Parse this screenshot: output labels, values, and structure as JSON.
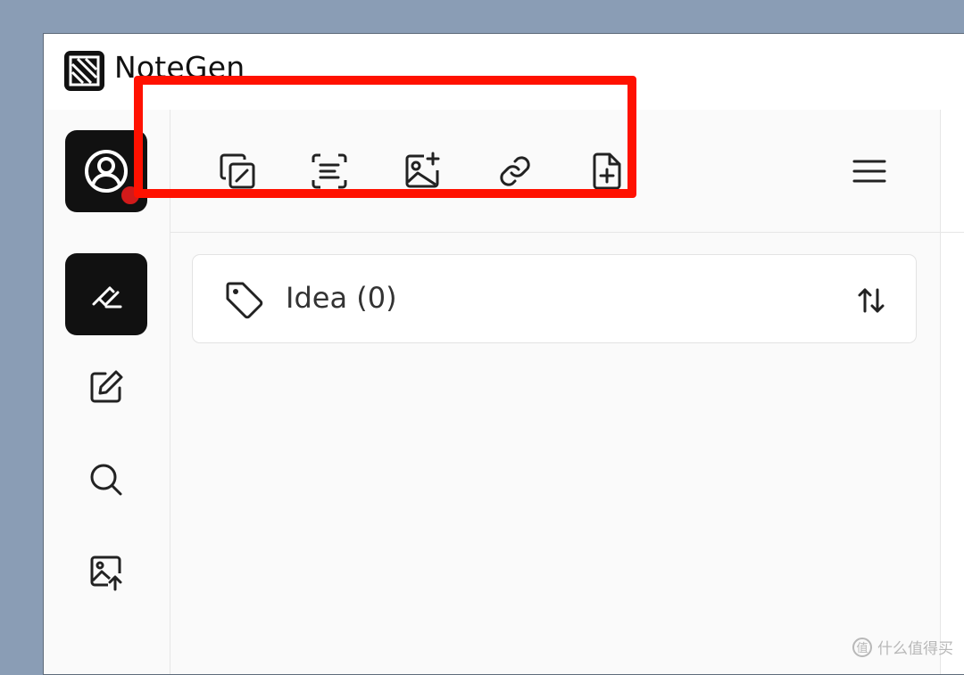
{
  "app": {
    "title": "NoteGen"
  },
  "sidebar": {
    "items": [
      {
        "name": "account",
        "icon": "user-circle-icon",
        "active": true,
        "notification": true
      },
      {
        "name": "record",
        "icon": "highlighter-icon",
        "active": true
      },
      {
        "name": "write",
        "icon": "edit-icon",
        "active": false
      },
      {
        "name": "search",
        "icon": "search-icon",
        "active": false
      },
      {
        "name": "image-upload",
        "icon": "image-upload-icon",
        "active": false
      }
    ]
  },
  "toolbar": {
    "tools": [
      {
        "name": "copy-text",
        "icon": "copy-icon"
      },
      {
        "name": "scan-text",
        "icon": "scan-text-icon"
      },
      {
        "name": "add-image",
        "icon": "image-plus-icon"
      },
      {
        "name": "add-link",
        "icon": "link-icon"
      },
      {
        "name": "add-file",
        "icon": "file-plus-icon"
      }
    ],
    "menu_icon": "menu-icon",
    "highlight_color": "#ff1100"
  },
  "tag_card": {
    "label": "Idea (0)",
    "icon": "tag-icon",
    "sort_icon": "sort-icon"
  },
  "watermark": {
    "glyph": "值",
    "text": "什么值得买"
  },
  "colors": {
    "accent_dark": "#111111",
    "notification": "#d11a1a",
    "desktop_bg": "#8a9db5"
  }
}
